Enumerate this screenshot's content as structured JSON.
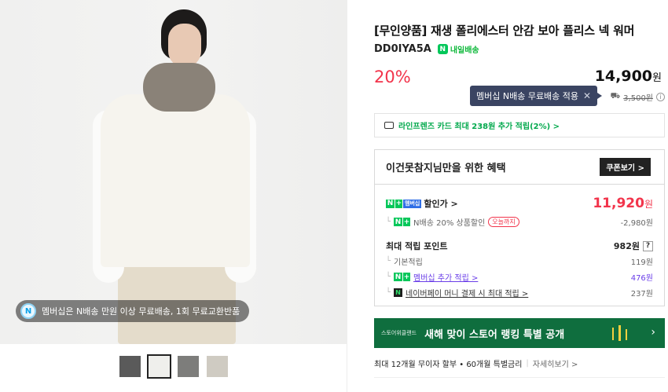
{
  "product": {
    "title": "[무인양품] 재생 폴리에스터 안감 보아 플리스 넥 워머",
    "code": "DD0IYA5A",
    "delivery_badge": "내일배송",
    "discount": "20%",
    "price": "14,900",
    "price_unit": "원",
    "original_price": "3,500원",
    "tooltip": "멤버십 N배송 무료배송 적용",
    "card_benefit": "라인프렌즈 카드 최대 238원 추가 적립(2%) >"
  },
  "photo_banner": "멤버십은 N배송 만원 이상 무료배송, 1회 무료교환반품",
  "thumbnails": [
    {
      "label": "thumb-1",
      "color": "#5a5a5a"
    },
    {
      "label": "thumb-2",
      "color": "#efefec"
    },
    {
      "label": "thumb-3",
      "color": "#7d7d7b"
    },
    {
      "label": "thumb-4",
      "color": "#cfcbc2"
    }
  ],
  "benefit": {
    "heading": "이건못참지님만을 위한 혜택",
    "coupon_button": "쿠폰보기 >",
    "sale_label": "할인가 >",
    "sale_price": "11,920",
    "sale_unit": "원",
    "nship_discount": "N배송 20% 상품할인",
    "today_tag": "오늘까지",
    "nship_amount": "-2,980원",
    "points_label": "최대 적립 포인트",
    "points_value": "982원",
    "points_help": "?",
    "basic_label": "기본적립",
    "basic_value": "119원",
    "member_label": "멤버십 추가 적립 >",
    "member_value": "476원",
    "npay_label": "네이버페이 머니 결제 시 최대 적립 >",
    "npay_value": "237원"
  },
  "promo": {
    "brand": "스토어위클랜드",
    "text": "새해 맞이 스토어 랭킹 특별 공개",
    "arrow": "›"
  },
  "installment": {
    "text": "최대 12개월 무이자 할부 • 60개월 특별금리",
    "more": "자세히보기 >"
  },
  "colors": {
    "accent_red": "#f2344b",
    "naver_green": "#03c75a",
    "promo_green": "#0f6e3e",
    "tooltip_bg": "#3a4462"
  }
}
